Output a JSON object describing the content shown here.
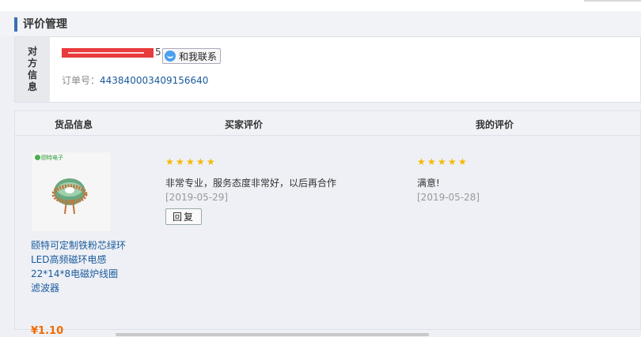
{
  "page": {
    "section_title": "评价管理"
  },
  "partner": {
    "label_chars": [
      "对",
      "方",
      "信",
      "息"
    ],
    "name_suffix": "5",
    "contact_label": "和我联系",
    "order_label": "订单号：",
    "order_number": "443840003409156640"
  },
  "reviews": {
    "headers": {
      "goods": "货品信息",
      "buyer": "买家评价",
      "mine": "我的评价"
    },
    "product": {
      "name": "颐特可定制铁粉芯绿环LED高频磁环电感22*14*8电磁炉线圈滤波器",
      "price": "¥1.10",
      "logo_text": "颐特电子"
    },
    "buyer_review": {
      "stars": 5,
      "text": "非常专业，服务态度非常好，以后再合作",
      "date": "[2019-05-29]",
      "reply_label": "回复"
    },
    "my_review": {
      "stars": 5,
      "text": "满意!",
      "date": "[2019-05-28]"
    }
  },
  "colors": {
    "accent": "#3a6fb2",
    "price": "#f26a00",
    "link": "#1a5a9c",
    "star": "#f6b800"
  }
}
